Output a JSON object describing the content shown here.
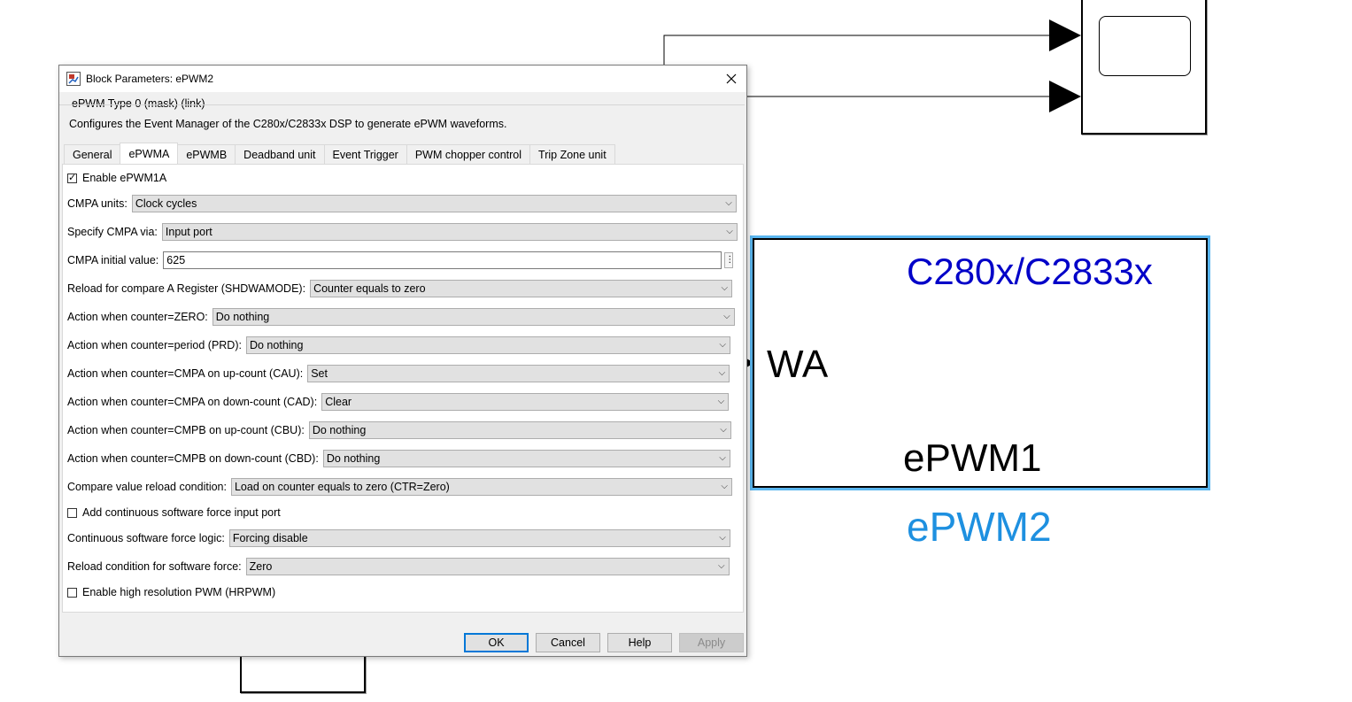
{
  "canvas": {
    "epwm_block": {
      "chip_label": "C280x/C2833x",
      "port_label": "WA",
      "module_label": "ePWM1",
      "block_name": "ePWM2"
    }
  },
  "dialog": {
    "title": "Block Parameters: ePWM2",
    "mask_type": "ePWM Type 0 (mask) (link)",
    "description": "Configures the Event Manager of the C280x/C2833x DSP to generate ePWM waveforms.",
    "tabs": [
      {
        "label": "General"
      },
      {
        "label": "ePWMA",
        "active": true
      },
      {
        "label": "ePWMB"
      },
      {
        "label": "Deadband unit"
      },
      {
        "label": "Event Trigger"
      },
      {
        "label": "PWM chopper control"
      },
      {
        "label": "Trip Zone unit"
      }
    ],
    "params": {
      "enable_epwm1a": {
        "label": "Enable ePWM1A",
        "checked": true
      },
      "cmpa_units": {
        "label": "CMPA units:",
        "value": "Clock cycles"
      },
      "specify_cmpa_via": {
        "label": "Specify CMPA via:",
        "value": "Input port"
      },
      "cmpa_initial_value": {
        "label": "CMPA initial value:",
        "value": "625"
      },
      "reload_compare_a": {
        "label": "Reload for compare A Register (SHDWAMODE):",
        "value": "Counter equals to zero"
      },
      "action_zero": {
        "label": "Action when counter=ZERO:",
        "value": "Do nothing"
      },
      "action_period": {
        "label": "Action when counter=period (PRD):",
        "value": "Do nothing"
      },
      "action_cau": {
        "label": "Action when counter=CMPA on up-count (CAU):",
        "value": "Set"
      },
      "action_cad": {
        "label": "Action when counter=CMPA on down-count (CAD):",
        "value": "Clear"
      },
      "action_cbu": {
        "label": "Action when counter=CMPB on up-count (CBU):",
        "value": "Do nothing"
      },
      "action_cbd": {
        "label": "Action when counter=CMPB on down-count (CBD):",
        "value": "Do nothing"
      },
      "compare_reload_condition": {
        "label": "Compare value reload condition:",
        "value": "Load on counter equals to zero (CTR=Zero)"
      },
      "add_sw_force_port": {
        "label": "Add continuous software force input port",
        "checked": false
      },
      "sw_force_logic": {
        "label": "Continuous software force logic:",
        "value": "Forcing disable"
      },
      "sw_force_reload": {
        "label": "Reload condition for software force:",
        "value": "Zero"
      },
      "enable_hrpwm": {
        "label": "Enable high resolution PWM (HRPWM)",
        "checked": false
      }
    },
    "buttons": {
      "ok": "OK",
      "cancel": "Cancel",
      "help": "Help",
      "apply": "Apply"
    }
  },
  "icons": {
    "close": "close-icon",
    "app": "simulink-block-icon",
    "dropdown": "chevron-down-icon",
    "check": "checkmark-icon",
    "field_menu": "kebab-menu-icon"
  },
  "colors": {
    "selection": "#5ab6ef",
    "chip_label": "#0000c8",
    "block_name": "#1e90e0",
    "ok_focus": "#0078d7"
  }
}
